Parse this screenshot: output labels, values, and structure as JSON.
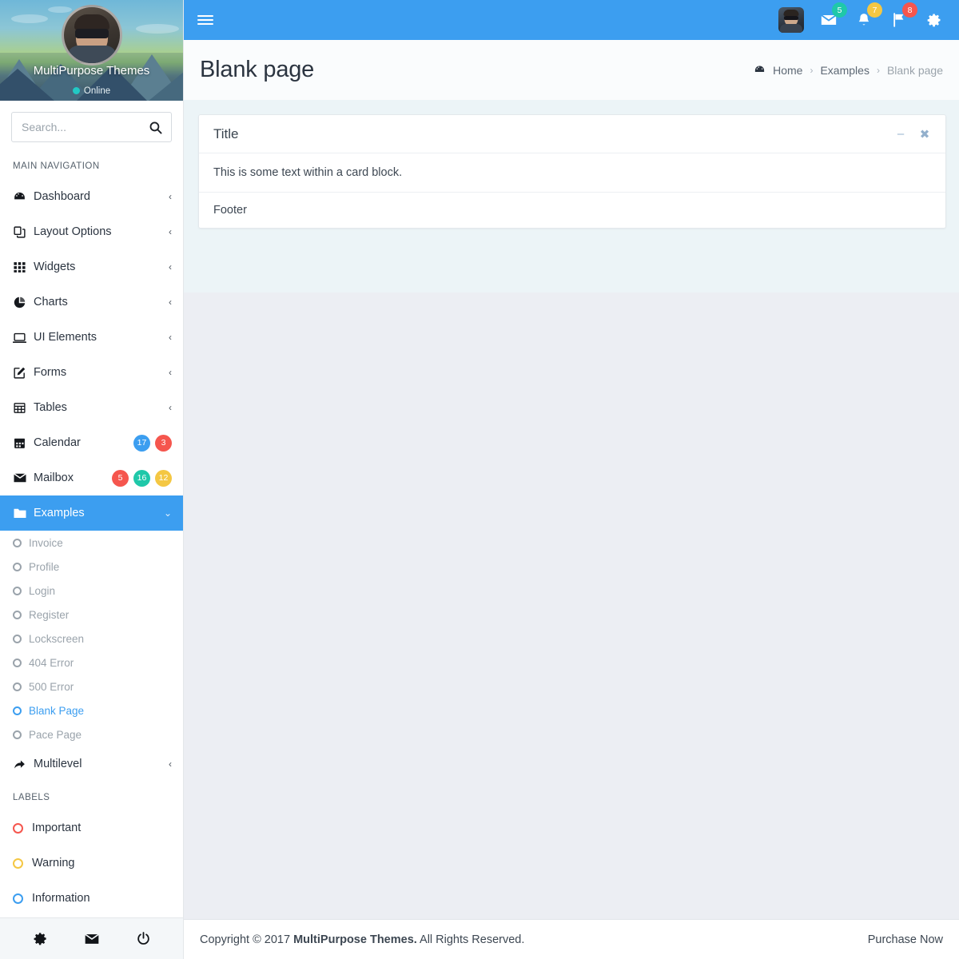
{
  "brand": {
    "name": "MultiPurpose Themes",
    "status": "Online",
    "accent": "#3c9ef0"
  },
  "search": {
    "placeholder": "Search...",
    "value": "",
    "icon": "search-icon"
  },
  "sidebar": {
    "sections": [
      {
        "heading": "MAIN NAVIGATION"
      },
      {
        "heading": "LABELS"
      }
    ],
    "items": [
      {
        "label": "Dashboard",
        "icon": "dashboard-icon",
        "arrow": "‹"
      },
      {
        "label": "Layout Options",
        "icon": "layers-icon",
        "arrow": "‹"
      },
      {
        "label": "Widgets",
        "icon": "grid-icon",
        "arrow": "‹"
      },
      {
        "label": "Charts",
        "icon": "pie-chart-icon",
        "arrow": "‹"
      },
      {
        "label": "UI Elements",
        "icon": "monitor-icon",
        "arrow": "‹"
      },
      {
        "label": "Forms",
        "icon": "edit-icon",
        "arrow": "‹"
      },
      {
        "label": "Tables",
        "icon": "table-icon",
        "arrow": "‹"
      },
      {
        "label": "Calendar",
        "icon": "calendar-icon",
        "badges": [
          {
            "text": "17",
            "color": "#3c9ef0"
          },
          {
            "text": "3",
            "color": "#f5564e"
          }
        ]
      },
      {
        "label": "Mailbox",
        "icon": "envelope-icon",
        "badges": [
          {
            "text": "5",
            "color": "#f5564e"
          },
          {
            "text": "16",
            "color": "#1fc8a9"
          },
          {
            "text": "12",
            "color": "#f4c743"
          }
        ]
      },
      {
        "label": "Examples",
        "icon": "folder-icon",
        "arrow": "⌄",
        "active": true
      }
    ],
    "submenu": [
      {
        "label": "Invoice"
      },
      {
        "label": "Profile"
      },
      {
        "label": "Login"
      },
      {
        "label": "Register"
      },
      {
        "label": "Lockscreen"
      },
      {
        "label": "404 Error"
      },
      {
        "label": "500 Error"
      },
      {
        "label": "Blank Page",
        "active": true
      },
      {
        "label": "Pace Page"
      }
    ],
    "after_submenu": [
      {
        "label": "Multilevel",
        "icon": "share-icon",
        "arrow": "‹"
      }
    ],
    "labels": [
      {
        "label": "Important",
        "color": "#f5564e"
      },
      {
        "label": "Warning",
        "color": "#f4c743"
      },
      {
        "label": "Information",
        "color": "#3c9ef0"
      }
    ],
    "footer_icons": [
      {
        "name": "gear-icon"
      },
      {
        "name": "envelope-icon"
      },
      {
        "name": "power-icon"
      }
    ]
  },
  "topbar": {
    "menu_toggle": "hamburger-icon",
    "user_avatar": "user-avatar",
    "icons": [
      {
        "name": "envelope-icon",
        "badge": "5",
        "badge_color": "#1fc8a9"
      },
      {
        "name": "bell-icon",
        "badge": "7",
        "badge_color": "#f4c743"
      },
      {
        "name": "flag-icon",
        "badge": "8",
        "badge_color": "#f5564e"
      },
      {
        "name": "gear-icon",
        "badge": "",
        "badge_color": ""
      }
    ]
  },
  "page": {
    "title": "Blank page",
    "breadcrumb": [
      {
        "label": "Home",
        "icon": "dashboard-icon"
      },
      {
        "label": "Examples"
      },
      {
        "label": "Blank page",
        "current": true
      }
    ],
    "separator": "›"
  },
  "card": {
    "title": "Title",
    "body": "This is some text within a card block.",
    "footer": "Footer",
    "minimize_icon": "minimize-icon",
    "close_icon": "close-icon",
    "minimize_glyph": "–",
    "close_glyph": "✖"
  },
  "footer": {
    "copyright_prefix": "Copyright © 2017 ",
    "copyright_brand": "MultiPurpose Themes.",
    "copyright_suffix": " All Rights Reserved.",
    "purchase": "Purchase Now"
  }
}
